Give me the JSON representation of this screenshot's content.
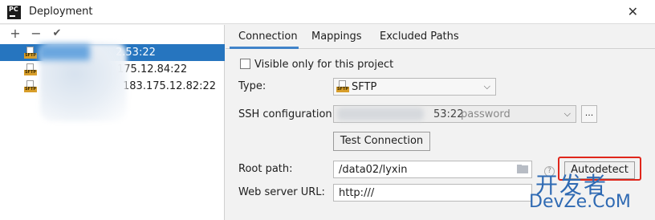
{
  "window": {
    "title": "Deployment",
    "app_icon_text": "PC"
  },
  "toolbar": {
    "add": "+",
    "remove": "−",
    "apply": "✔"
  },
  "servers": [
    {
      "name": "2.53:22",
      "type_icon": "sftp-icon",
      "selected": true
    },
    {
      "name": "175.12.84:22",
      "type_icon": "sftp-icon",
      "selected": false
    },
    {
      "name": "183.175.12.82:22",
      "type_icon": "sftp-icon",
      "selected": false
    }
  ],
  "tabs": [
    {
      "label": "Connection",
      "active": true
    },
    {
      "label": "Mappings",
      "active": false
    },
    {
      "label": "Excluded Paths",
      "active": false
    }
  ],
  "connection": {
    "visible_only_label": "Visible only for this project",
    "visible_only_checked": false,
    "type_label": "Type:",
    "type_value": "SFTP",
    "ssh_label": "SSH configuration:",
    "ssh_value": "53:22",
    "ssh_suffix": "password",
    "ssh_more": "...",
    "test_button": "Test Connection",
    "root_label": "Root path:",
    "root_value": "/data02/lyxin",
    "autodetect_button": "Autodetect",
    "web_label": "Web server URL:",
    "web_value": "http:///",
    "help": "?"
  },
  "watermark": {
    "cn": "开发者",
    "en": "DevZe.CoM",
    "icon": "⌂"
  },
  "colors": {
    "selection": "#2675bf",
    "tab_accent": "#4083c9",
    "highlight": "#e0261b",
    "sftp_tag": "#d89e2a"
  }
}
